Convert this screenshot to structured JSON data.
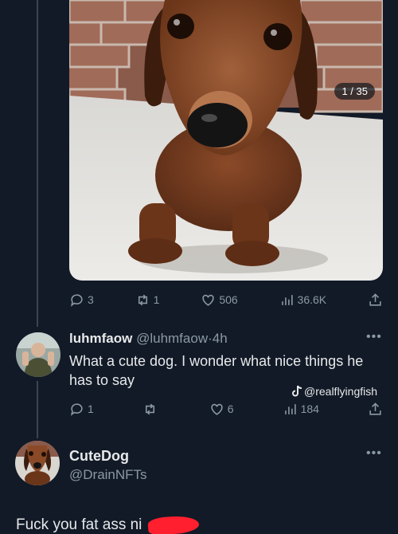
{
  "image_counter": "1 / 35",
  "post_actions": {
    "replies": "3",
    "retweets": "1",
    "likes": "506",
    "views": "36.6K"
  },
  "reply1": {
    "display_name": "luhmfaow",
    "handle": "@luhmfaow",
    "separator": "·",
    "time": "4h",
    "text": "What a cute dog. I wonder what nice things he has to say",
    "actions": {
      "replies": "1",
      "retweets": "",
      "likes": "6",
      "views": "184"
    }
  },
  "watermark": "@realflyingfish",
  "reply2": {
    "display_name": "CuteDog",
    "handle": "@DrainNFTs",
    "text": "Fuck you fat ass ni"
  },
  "icons": {
    "reply": "comment-icon",
    "retweet": "retweet-icon",
    "like": "heart-icon",
    "views": "bar-chart-icon",
    "share": "share-icon",
    "tiktok": "tiktok-icon",
    "more": "more-dots-icon"
  },
  "colors": {
    "background": "#121a27",
    "muted": "#8b98a5",
    "censor": "#ff1f2e"
  }
}
